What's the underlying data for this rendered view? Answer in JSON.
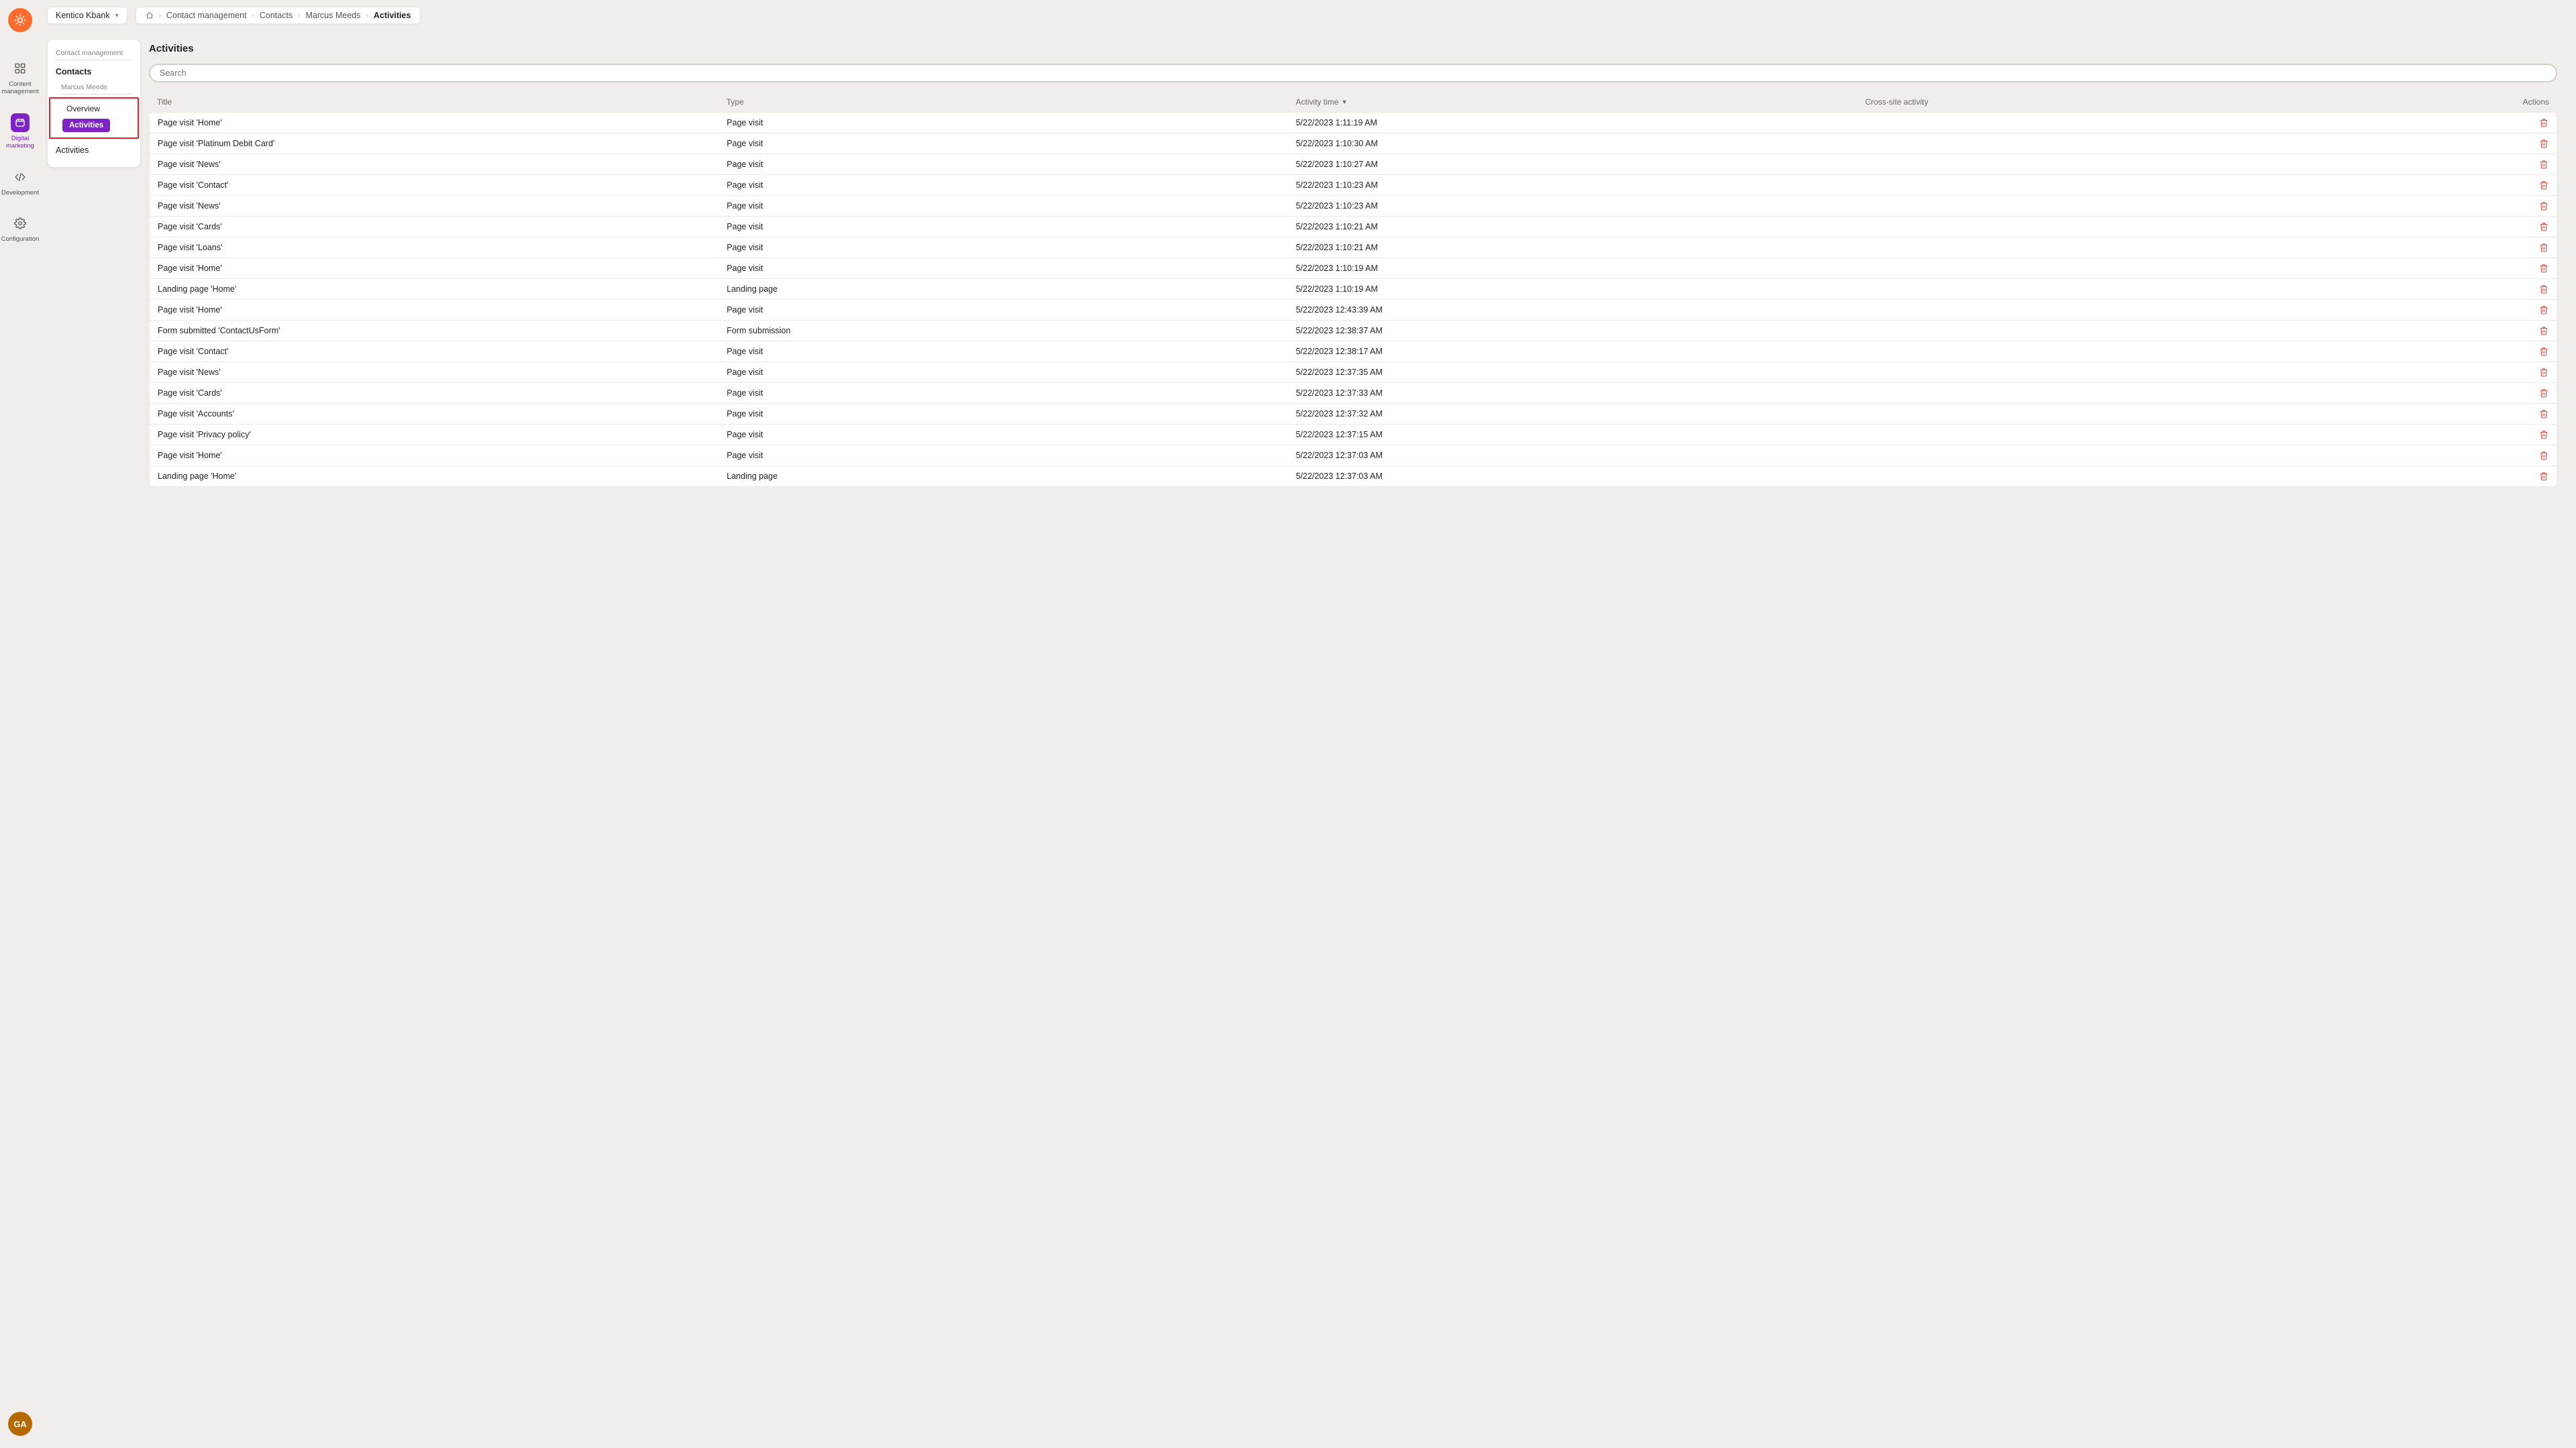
{
  "site_picker": {
    "label": "Kentico Kbank"
  },
  "breadcrumb": [
    "Contact management",
    "Contacts",
    "Marcus Meeds",
    "Activities"
  ],
  "avatar": "GA",
  "rail": [
    {
      "label": "Content management",
      "icon": "content"
    },
    {
      "label": "Digital marketing",
      "icon": "marketing",
      "active": true
    },
    {
      "label": "Development",
      "icon": "dev"
    },
    {
      "label": "Configuration",
      "icon": "config"
    }
  ],
  "nav": {
    "section": "Contact management",
    "contacts_label": "Contacts",
    "contact_name": "Marcus Meeds",
    "overview_label": "Overview",
    "activities_pill": "Activities",
    "activities_label": "Activities"
  },
  "page": {
    "title": "Activities",
    "search_placeholder": "Search"
  },
  "columns": {
    "title": "Title",
    "type": "Type",
    "time": "Activity time",
    "cross": "Cross-site activity",
    "actions": "Actions"
  },
  "rows": [
    {
      "title": "Page visit 'Home'",
      "type": "Page visit",
      "time": "5/22/2023 1:11:19 AM"
    },
    {
      "title": "Page visit 'Platinum Debit Card'",
      "type": "Page visit",
      "time": "5/22/2023 1:10:30 AM"
    },
    {
      "title": "Page visit 'News'",
      "type": "Page visit",
      "time": "5/22/2023 1:10:27 AM"
    },
    {
      "title": "Page visit 'Contact'",
      "type": "Page visit",
      "time": "5/22/2023 1:10:23 AM"
    },
    {
      "title": "Page visit 'News'",
      "type": "Page visit",
      "time": "5/22/2023 1:10:23 AM"
    },
    {
      "title": "Page visit 'Cards'",
      "type": "Page visit",
      "time": "5/22/2023 1:10:21 AM"
    },
    {
      "title": "Page visit 'Loans'",
      "type": "Page visit",
      "time": "5/22/2023 1:10:21 AM"
    },
    {
      "title": "Page visit 'Home'",
      "type": "Page visit",
      "time": "5/22/2023 1:10:19 AM"
    },
    {
      "title": "Landing page 'Home'",
      "type": "Landing page",
      "time": "5/22/2023 1:10:19 AM"
    },
    {
      "title": "Page visit 'Home'",
      "type": "Page visit",
      "time": "5/22/2023 12:43:39 AM"
    },
    {
      "title": "Form submitted 'ContactUsForm'",
      "type": "Form submission",
      "time": "5/22/2023 12:38:37 AM"
    },
    {
      "title": "Page visit 'Contact'",
      "type": "Page visit",
      "time": "5/22/2023 12:38:17 AM"
    },
    {
      "title": "Page visit 'News'",
      "type": "Page visit",
      "time": "5/22/2023 12:37:35 AM"
    },
    {
      "title": "Page visit 'Cards'",
      "type": "Page visit",
      "time": "5/22/2023 12:37:33 AM"
    },
    {
      "title": "Page visit 'Accounts'",
      "type": "Page visit",
      "time": "5/22/2023 12:37:32 AM"
    },
    {
      "title": "Page visit 'Privacy policy'",
      "type": "Page visit",
      "time": "5/22/2023 12:37:15 AM"
    },
    {
      "title": "Page visit 'Home'",
      "type": "Page visit",
      "time": "5/22/2023 12:37:03 AM"
    },
    {
      "title": "Landing page 'Home'",
      "type": "Landing page",
      "time": "5/22/2023 12:37:03 AM"
    }
  ]
}
